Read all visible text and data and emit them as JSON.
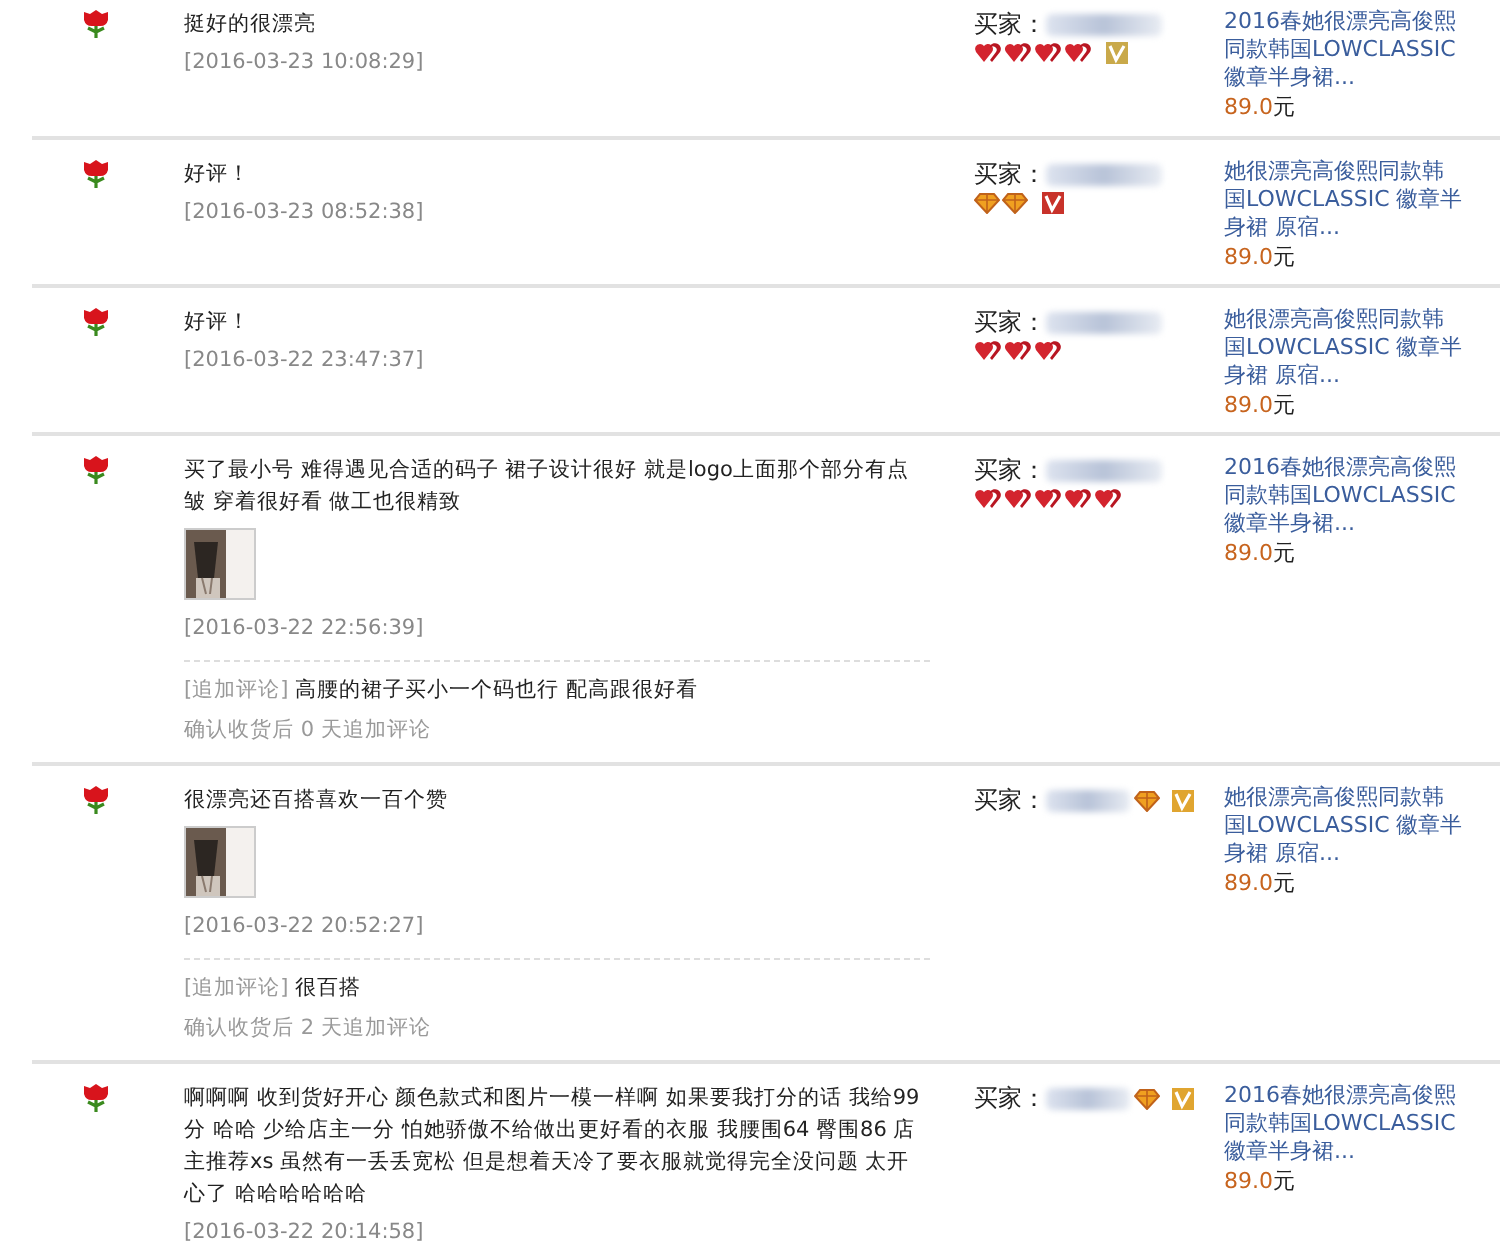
{
  "reviews": [
    {
      "comment": "挺好的很漂亮",
      "time": "[2016-03-23 10:08:29]",
      "buyer": {
        "label": "买家：",
        "rank_inline": false,
        "rank": [
          {
            "kind": "heart"
          },
          {
            "kind": "heart"
          },
          {
            "kind": "heart"
          },
          {
            "kind": "heart"
          }
        ],
        "vip": {
          "color": "#c9a94a"
        }
      },
      "product": {
        "title": "2016春她很漂亮高俊熙同款韩国LOWCLASSIC 徽章半身裙...",
        "price": "89.0",
        "unit": "元"
      }
    },
    {
      "comment": "好评！",
      "time": "[2016-03-23 08:52:38]",
      "buyer": {
        "label": "买家：",
        "rank_inline": false,
        "rank": [
          {
            "kind": "diamond"
          },
          {
            "kind": "diamond"
          }
        ],
        "vip": {
          "color": "#c8322a"
        }
      },
      "product": {
        "title": "她很漂亮高俊熙同款韩国LOWCLASSIC 徽章半身裙 原宿...",
        "price": "89.0",
        "unit": "元"
      }
    },
    {
      "comment": "好评！",
      "time": "[2016-03-22 23:47:37]",
      "buyer": {
        "label": "买家：",
        "rank_inline": false,
        "rank": [
          {
            "kind": "heart"
          },
          {
            "kind": "heart"
          },
          {
            "kind": "heart"
          }
        ]
      },
      "product": {
        "title": "她很漂亮高俊熙同款韩国LOWCLASSIC 徽章半身裙 原宿...",
        "price": "89.0",
        "unit": "元"
      }
    },
    {
      "comment": "买了最小号 难得遇见合适的码子 裙子设计很好 就是logo上面那个部分有点皱 穿着很好看 做工也很精致",
      "time": "[2016-03-22 22:56:39]",
      "follow_up": {
        "label": "[追加评论]",
        "text": "高腰的裙子买小一个码也行 配高跟很好看",
        "note": "确认收货后 0 天追加评论"
      },
      "buyer": {
        "label": "买家：",
        "rank_inline": false,
        "rank": [
          {
            "kind": "heart"
          },
          {
            "kind": "heart"
          },
          {
            "kind": "heart"
          },
          {
            "kind": "heart"
          },
          {
            "kind": "heart"
          }
        ]
      },
      "product": {
        "title": "2016春她很漂亮高俊熙同款韩国LOWCLASSIC 徽章半身裙...",
        "price": "89.0",
        "unit": "元"
      }
    },
    {
      "comment": "很漂亮还百搭喜欢一百个赞",
      "time": "[2016-03-22 20:52:27]",
      "follow_up": {
        "label": "[追加评论]",
        "text": "很百搭",
        "note": "确认收货后 2 天追加评论"
      },
      "buyer": {
        "label": "买家：",
        "rank_inline": true,
        "rank": [
          {
            "kind": "diamond"
          }
        ],
        "vip": {
          "color": "#e0a530"
        }
      },
      "product": {
        "title": "她很漂亮高俊熙同款韩国LOWCLASSIC 徽章半身裙 原宿...",
        "price": "89.0",
        "unit": "元"
      }
    },
    {
      "comment": "啊啊啊 收到货好开心 颜色款式和图片一模一样啊 如果要我打分的话 我给99分 哈哈 少给店主一分 怕她骄傲不给做出更好看的衣服 我腰围64 臀围86 店主推荐xs 虽然有一丢丢宽松 但是想着天冷了要衣服就觉得完全没问题 太开心了 哈哈哈哈哈哈",
      "time": "[2016-03-22 20:14:58]",
      "buyer": {
        "label": "买家：",
        "rank_inline": true,
        "rank": [
          {
            "kind": "diamond"
          }
        ],
        "vip": {
          "color": "#e0a530"
        }
      },
      "product": {
        "title": "2016春她很漂亮高俊熙同款韩国LOWCLASSIC 徽章半身裙...",
        "price": "89.0",
        "unit": "元"
      }
    }
  ]
}
